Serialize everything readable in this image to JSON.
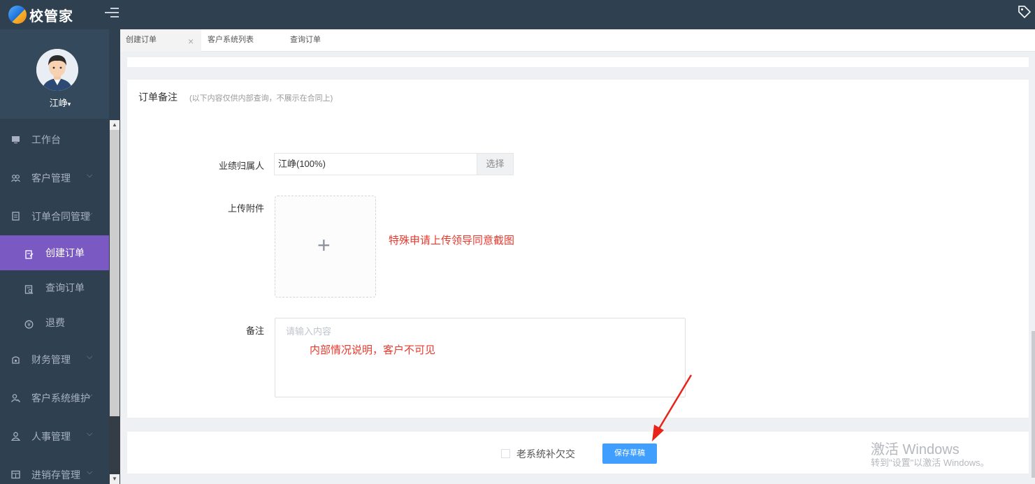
{
  "app": {
    "logo_text": "校管家"
  },
  "user": {
    "name": "江峥",
    "caret": "▾"
  },
  "sidebar": {
    "items": [
      {
        "label": "工作台",
        "icon": "monitor-icon",
        "has_chevron": false
      },
      {
        "label": "客户管理",
        "icon": "users-icon",
        "has_chevron": true,
        "chevron": "⌵"
      },
      {
        "label": "订单合同管理",
        "icon": "document-icon",
        "has_chevron": true,
        "chevron": "⌵"
      },
      {
        "label": "创建订单",
        "icon": "create-order-icon",
        "sub": true,
        "active": true
      },
      {
        "label": "查询订单",
        "icon": "search-order-icon",
        "sub": true
      },
      {
        "label": "退费",
        "icon": "refund-icon",
        "sub": true
      },
      {
        "label": "财务管理",
        "icon": "finance-icon",
        "has_chevron": true,
        "chevron": "⌵"
      },
      {
        "label": "客户系统维护",
        "icon": "maintenance-icon",
        "has_chevron": true,
        "chevron": "⌵"
      },
      {
        "label": "人事管理",
        "icon": "person-icon",
        "has_chevron": true,
        "chevron": "⌵"
      },
      {
        "label": "进销存管理",
        "icon": "inventory-icon",
        "has_chevron": true,
        "chevron": "⌵"
      }
    ]
  },
  "tabs": [
    {
      "label": "创建订单",
      "active": true,
      "close": "×"
    },
    {
      "label": "客户系统列表",
      "active": false
    },
    {
      "label": "查询订单",
      "active": false
    }
  ],
  "form": {
    "section_title": "订单备注",
    "section_hint": "(以下内容仅供内部查询，不展示在合同上)",
    "performance_label": "业绩归属人",
    "performance_value": "江峥(100%)",
    "select_button": "选择",
    "upload_label": "上传附件",
    "upload_plus": "+",
    "upload_annotation": "特殊申请上传领导同意截图",
    "remark_label": "备注",
    "remark_placeholder": "请输入内容",
    "remark_annotation": "内部情况说明，客户不可见"
  },
  "footer": {
    "checkbox_label": "老系统补欠交",
    "save_button": "保存草稿"
  },
  "watermark": {
    "line1": "激活 Windows",
    "line2": "转到\"设置\"以激活 Windows。"
  },
  "colors": {
    "sidebar_bg": "#2f4050",
    "active_nav": "#7a59c2",
    "primary_button": "#409eff",
    "annotation_red": "#e8392c"
  }
}
